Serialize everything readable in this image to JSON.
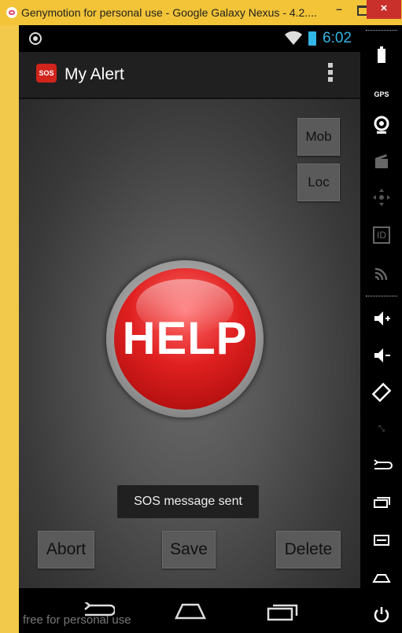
{
  "window": {
    "title": "Genymotion for personal use - Google Galaxy Nexus - 4.2....",
    "min_label": "–",
    "close_label": "×"
  },
  "status_bar": {
    "time": "6:02"
  },
  "action_bar": {
    "logo_text": "SOS",
    "title": "My Alert"
  },
  "buttons": {
    "mob": "Mob",
    "loc": "Loc",
    "help": "HELP",
    "abort": "Abort",
    "save": "Save",
    "delete": "Delete"
  },
  "toast": "SOS message sent",
  "watermark": "free for personal use",
  "right_panel": {
    "gps_label": "GPS",
    "id_label": "ID",
    "icons": [
      "battery-icon",
      "gps-icon",
      "camera-icon",
      "clapper-icon",
      "dpad-icon",
      "id-icon",
      "cast-icon",
      "volume-up-icon",
      "volume-down-icon",
      "rotate-icon",
      "scale-icon",
      "back-icon",
      "recent-apps-icon",
      "menu-icon",
      "home-icon",
      "power-icon"
    ]
  },
  "colors": {
    "accent": "#33b5e5",
    "help_red": "#e02020",
    "close_red": "#c9302c"
  }
}
